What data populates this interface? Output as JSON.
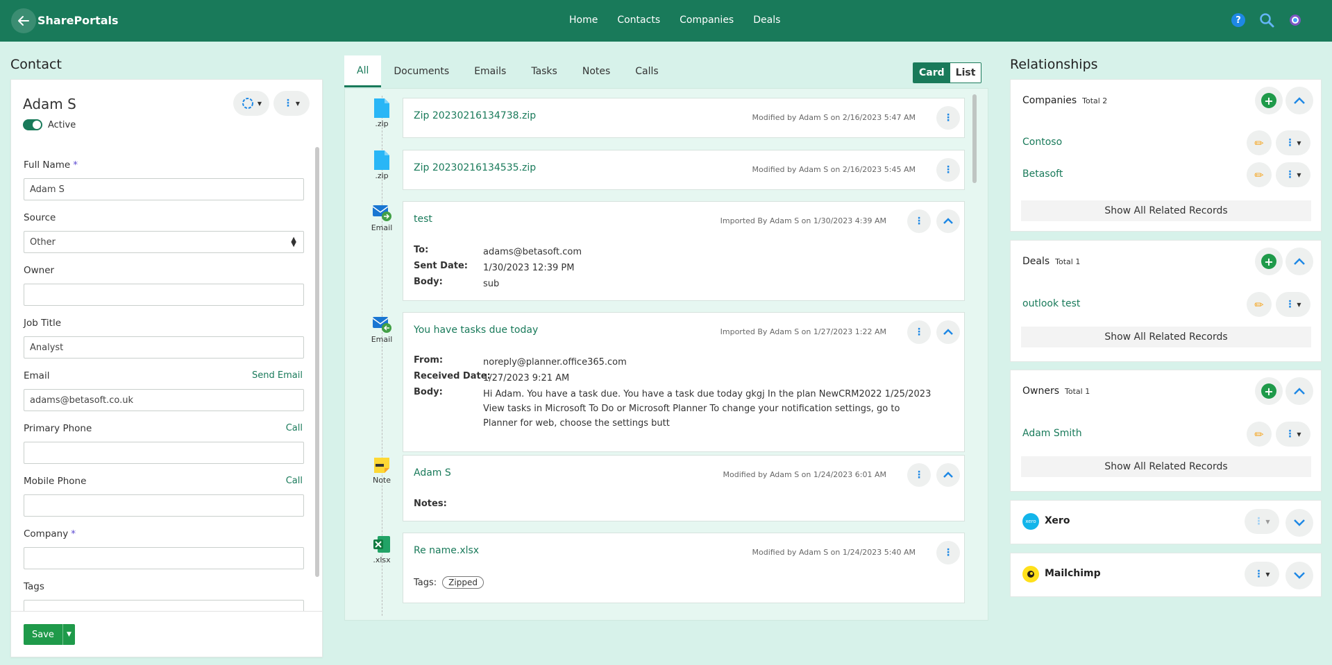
{
  "app": {
    "brand": "SharePortals"
  },
  "nav": [
    "Home",
    "Contacts",
    "Companies",
    "Deals"
  ],
  "contact": {
    "section_title": "Contact",
    "name": "Adam S",
    "status": "Active",
    "fields": {
      "full_name_label": "Full Name",
      "full_name_value": "Adam S",
      "source_label": "Source",
      "source_value": "Other",
      "owner_label": "Owner",
      "owner_value": "",
      "job_title_label": "Job Title",
      "job_title_value": "Analyst",
      "email_label": "Email",
      "email_link": "Send Email",
      "email_value": "adams@betasoft.co.uk",
      "primary_phone_label": "Primary Phone",
      "primary_phone_link": "Call",
      "mobile_phone_label": "Mobile Phone",
      "mobile_phone_link": "Call",
      "company_label": "Company",
      "tags_label": "Tags",
      "required_mark": "*"
    },
    "save_label": "Save"
  },
  "timeline": {
    "tabs": [
      "All",
      "Documents",
      "Emails",
      "Tasks",
      "Notes",
      "Calls"
    ],
    "view_card": "Card",
    "view_list": "List",
    "items": [
      {
        "icon_label": ".zip",
        "title": "Zip 20230216134738.zip",
        "meta": "Modified by Adam S on 2/16/2023 5:47 AM"
      },
      {
        "icon_label": ".zip",
        "title": "Zip 20230216134535.zip",
        "meta": "Modified by Adam S on 2/16/2023 5:45 AM"
      },
      {
        "icon_label": "Email",
        "title": "test",
        "meta": "Imported By Adam S on 1/30/2023 4:39 AM",
        "to_label": "To:",
        "to_value": "adams@betasoft.com",
        "sent_label": "Sent Date:",
        "sent_value": "1/30/2023 12:39 PM",
        "body_label": "Body:",
        "body_value": "sub"
      },
      {
        "icon_label": "Email",
        "title": "You have tasks due today",
        "meta": "Imported By Adam S on 1/27/2023 1:22 AM",
        "from_label": "From:",
        "from_value": "noreply@planner.office365.com",
        "received_label": "Received Date:",
        "received_value": "1/27/2023 9:21 AM",
        "body_label": "Body:",
        "body_value": "Hi Adam. You have a task due. You have a task due today gkgj In the plan NewCRM2022 1/25/2023 View tasks in Microsoft To Do or Microsoft Planner To change your notification settings, go to Planner for web, choose the settings butt"
      },
      {
        "icon_label": "Note",
        "title": "Adam S",
        "meta": "Modified by Adam S on 1/24/2023 6:01 AM",
        "notes_label": "Notes:"
      },
      {
        "icon_label": ".xlsx",
        "title": "Re name.xlsx",
        "meta": "Modified by Adam S on 1/24/2023 5:40 AM",
        "tags_label": "Tags:",
        "tag": "Zipped"
      }
    ]
  },
  "relationships": {
    "section_title": "Relationships",
    "show_all": "Show All Related Records",
    "companies": {
      "title": "Companies",
      "total": "Total 2",
      "items": [
        "Contoso",
        "Betasoft"
      ]
    },
    "deals": {
      "title": "Deals",
      "total": "Total 1",
      "items": [
        "outlook test"
      ]
    },
    "owners": {
      "title": "Owners",
      "total": "Total 1",
      "items": [
        "Adam Smith"
      ]
    },
    "xero": {
      "title": "Xero",
      "logo_text": "xero"
    },
    "mailchimp": {
      "title": "Mailchimp"
    }
  },
  "colors": {
    "primary": "#197a5a",
    "background": "#d7f2ea",
    "accent_blue": "#1e88e5",
    "save_green": "#1f9a4a"
  }
}
